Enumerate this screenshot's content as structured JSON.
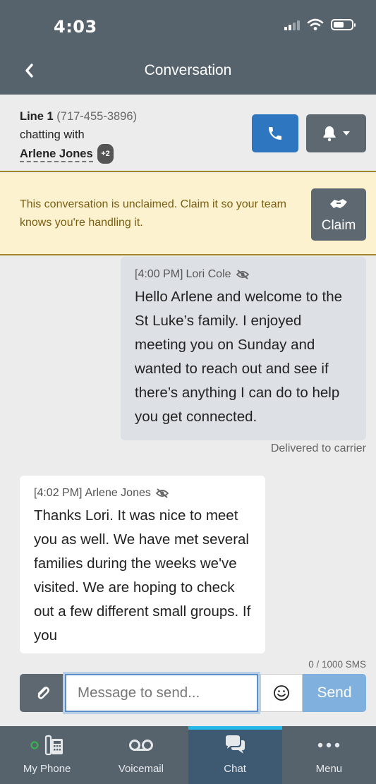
{
  "status_bar": {
    "time": "4:03"
  },
  "header": {
    "title": "Conversation"
  },
  "line_info": {
    "line_label": "Line 1",
    "line_number": "(717-455-3896)",
    "chatting_with": "chatting with",
    "contact_name": "Arlene Jones",
    "extra_participants": "+2"
  },
  "claim_banner": {
    "text": "This conversation is unclaimed. Claim it so your team knows you're handling it.",
    "button_label": "Claim"
  },
  "messages": [
    {
      "direction": "outgoing",
      "time": "[4:00 PM]",
      "sender": "Lori Cole",
      "text": "Hello Arlene and welcome to the St Luke’s family. I enjoyed meeting you on Sunday and wanted to reach out and see if there’s anything I can do to help you get connected.",
      "status": "Delivered to carrier"
    },
    {
      "direction": "incoming",
      "time": "[4:02 PM]",
      "sender": "Arlene Jones",
      "text": "Thanks Lori. It was nice to meet you as well. We have met several families during the weeks we've visited. We are hoping to check out a few different small groups. If you"
    }
  ],
  "compose": {
    "sms_counter": "0 / 1000 SMS",
    "placeholder": "Message to send...",
    "send_label": "Send"
  },
  "tabs": [
    {
      "label": "My Phone",
      "icon": "desk-phone-icon",
      "active": false
    },
    {
      "label": "Voicemail",
      "icon": "voicemail-icon",
      "active": false
    },
    {
      "label": "Chat",
      "icon": "chat-bubbles-icon",
      "active": true
    },
    {
      "label": "Menu",
      "icon": "more-dots-icon",
      "active": false
    }
  ],
  "colors": {
    "header_bg": "#56626c",
    "call_button": "#2e77c0",
    "banner_bg": "#fcf2cf",
    "banner_text": "#7a5d10",
    "send_button": "#7fb0de",
    "active_tab_indicator": "#25b7e8",
    "presence_dot": "#37b24d"
  }
}
